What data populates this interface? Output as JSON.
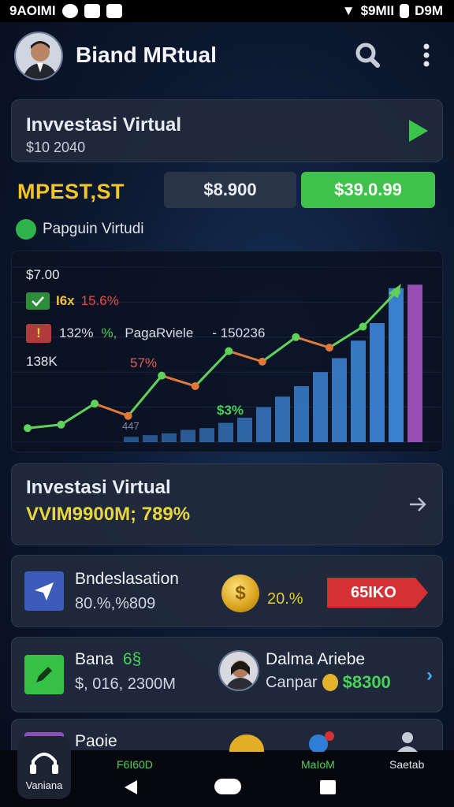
{
  "status_bar": {
    "left_text": "9AOIMI",
    "right_text": "$9MII",
    "time": "D9M"
  },
  "header": {
    "title": "Biand MRtual"
  },
  "invest_card": {
    "title": "Invvestasi Virtual",
    "amount": "$10 2040"
  },
  "section": {
    "label": "MPEST,ST",
    "button_a": "$8.900",
    "button_b": "$39.0.99",
    "sub_label": "Papguin Virtudi"
  },
  "chart_panel": {
    "price": "$7.00",
    "gold_text": "I6x",
    "red_pct": "15.6%",
    "info_pct": "132%",
    "info_green": "%,",
    "info_text": "PagaRviele",
    "side_value": "- 150236",
    "left_value": "138K",
    "mid_pct": "57%",
    "green_pct": "$3%",
    "tiny": "447"
  },
  "chart_data": {
    "type": "line",
    "line_points": [
      {
        "x": 1,
        "y": 8
      },
      {
        "x": 2,
        "y": 10
      },
      {
        "x": 3,
        "y": 22
      },
      {
        "x": 4,
        "y": 15
      },
      {
        "x": 5,
        "y": 38
      },
      {
        "x": 6,
        "y": 32
      },
      {
        "x": 7,
        "y": 52
      },
      {
        "x": 8,
        "y": 46
      },
      {
        "x": 9,
        "y": 60
      },
      {
        "x": 10,
        "y": 54
      },
      {
        "x": 11,
        "y": 66
      },
      {
        "x": 12,
        "y": 86
      }
    ],
    "bars": [
      3,
      4,
      5,
      7,
      8,
      11,
      14,
      20,
      26,
      32,
      40,
      48,
      58,
      68,
      88,
      90
    ],
    "line_colors": {
      "up": "#5fd25a",
      "down": "#e0783a"
    },
    "bar_color": "#3c86d8",
    "ylim": [
      0,
      100
    ]
  },
  "invest_card_2": {
    "title": "Investasi Virtual",
    "value": "VVIM9900M; 789%"
  },
  "rows": [
    {
      "title": "Bndeslasation",
      "subtitle": "80.%,%809",
      "pct": "20.%",
      "tag": "65IKO",
      "icon_color": "#3d5bb8",
      "tag_color": "#d62f34"
    },
    {
      "title": "Bana",
      "title_extra": "6§",
      "subtitle": "$, 016, 2300M",
      "person": "Dalma Ariebe",
      "person_sub": "Canpar",
      "amount": "$8300",
      "icon_color": "#35c145"
    },
    {
      "title": "Paoie",
      "icon_color": "#8a4fb6"
    }
  ],
  "bottom_nav": {
    "home_label": "Vaniana",
    "item2": "F6I60D",
    "item3": "MaIoM",
    "item4": "Saetab"
  }
}
